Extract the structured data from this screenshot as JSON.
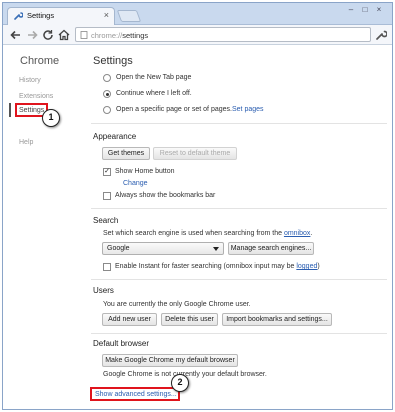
{
  "window": {
    "tab_title": "Settings",
    "tab_close_glyph": "×",
    "controls": {
      "minimize": "–",
      "maximize": "□",
      "close": "×"
    }
  },
  "toolbar": {
    "url_scheme": "chrome://",
    "url_path": "settings",
    "back_icon": "back-arrow-icon",
    "forward_icon": "forward-arrow-icon",
    "reload_icon": "reload-icon",
    "home_icon": "home-icon",
    "menu_icon": "wrench-icon"
  },
  "sidebar": {
    "title": "Chrome",
    "items": [
      {
        "label": "History",
        "active": false
      },
      {
        "label": "Extensions",
        "active": false
      },
      {
        "label": "Settings",
        "active": true
      },
      {
        "label": "Help",
        "active": false
      }
    ]
  },
  "settings": {
    "title": "Settings",
    "startup": {
      "options": [
        {
          "label": "Open the New Tab page",
          "checked": false
        },
        {
          "label": "Continue where I left off.",
          "checked": true
        },
        {
          "label": "Open a specific page or set of pages.",
          "checked": false,
          "link": "Set pages"
        }
      ]
    },
    "appearance": {
      "heading": "Appearance",
      "get_themes": "Get themes",
      "reset_theme": "Reset to default theme",
      "show_home": "Show Home button",
      "show_home_checked": true,
      "change_link": "Change",
      "bookmarks_bar": "Always show the bookmarks bar",
      "bookmarks_bar_checked": false
    },
    "search": {
      "heading": "Search",
      "description": "Set which search engine is used when searching from the ",
      "omnibox_link": "omnibox",
      "engine": "Google",
      "manage_button": "Manage search engines...",
      "instant_label": "Enable Instant for faster searching (omnibox input may be ",
      "logged_link": "logged",
      "instant_checked": false
    },
    "users": {
      "heading": "Users",
      "description": "You are currently the only Google Chrome user.",
      "add_user": "Add new user",
      "delete_user": "Delete this user",
      "import": "Import bookmarks and settings..."
    },
    "default_browser": {
      "heading": "Default browser",
      "button": "Make Google Chrome my default browser",
      "status": "Google Chrome is not currently your default browser."
    },
    "advanced_link": "Show advanced settings..."
  },
  "annotations": {
    "marker_1": "1",
    "marker_2": "2",
    "highlight_color": "#e0141d"
  }
}
